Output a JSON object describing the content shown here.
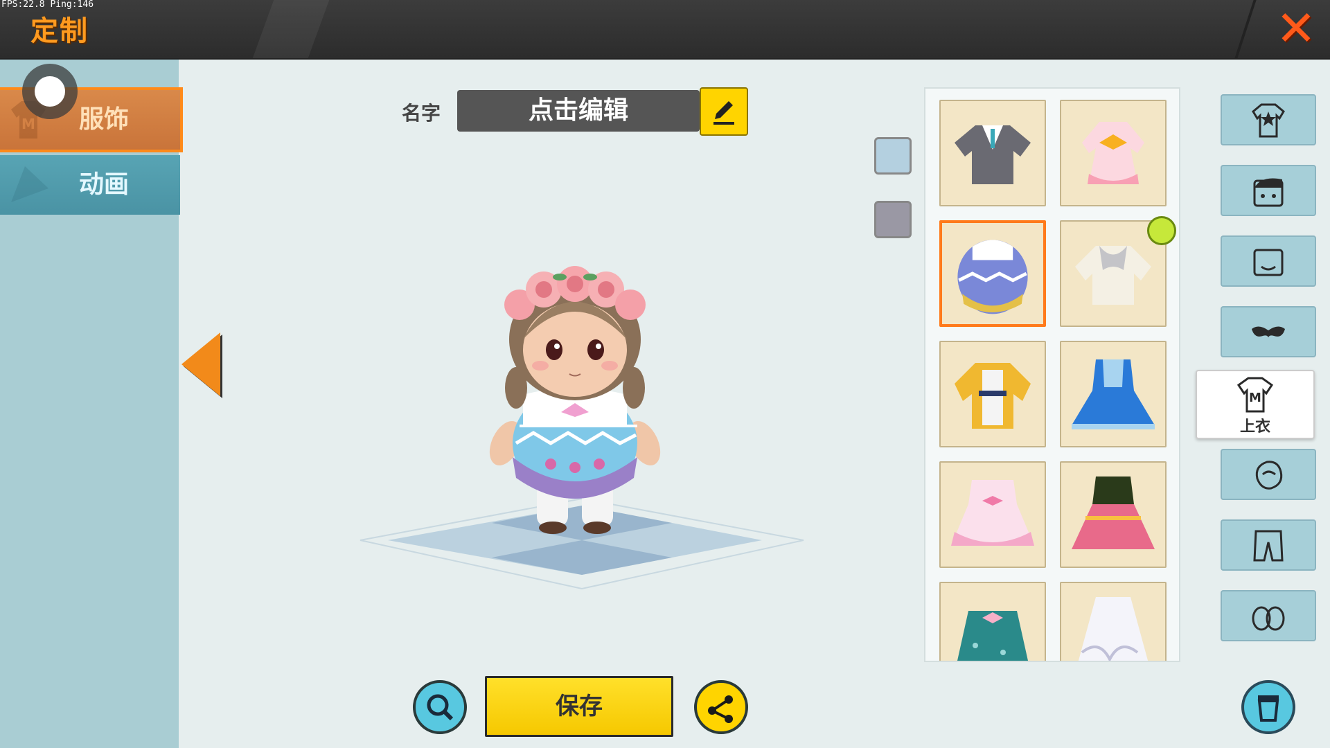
{
  "hud": {
    "fps": "FPS:22.8  Ping:146"
  },
  "header": {
    "title": "定制",
    "close_icon": "close-icon"
  },
  "left_tabs": [
    {
      "label": "服饰",
      "icon": "shirt-m-icon",
      "active": true
    },
    {
      "label": "动画",
      "icon": "triangle-icon",
      "active": false
    }
  ],
  "name_field": {
    "label": "名字",
    "value": "点击编辑",
    "edit_icon": "pencil-icon"
  },
  "colors": {
    "swatch_1": "#b4d0e0",
    "swatch_2": "#9a98a4",
    "accent": "#ff7a1a",
    "save": "#ffd400"
  },
  "items": [
    {
      "name": "gray-sweater-top",
      "selected": false
    },
    {
      "name": "pink-bow-dress-top",
      "selected": false
    },
    {
      "name": "easter-egg-costume",
      "selected": true
    },
    {
      "name": "cream-knit-sweater",
      "selected": false,
      "timed": true
    },
    {
      "name": "yellow-jacket",
      "selected": false
    },
    {
      "name": "blue-dress",
      "selected": false
    },
    {
      "name": "pink-lolita-dress",
      "selected": false
    },
    {
      "name": "green-pink-petal-dress",
      "selected": false
    },
    {
      "name": "teal-polka-dress",
      "selected": false
    },
    {
      "name": "white-feather-dress",
      "selected": false
    }
  ],
  "categories": [
    {
      "icon": "star-shirt-icon"
    },
    {
      "icon": "hair-icon"
    },
    {
      "icon": "face-icon"
    },
    {
      "icon": "mask-icon"
    },
    {
      "icon": "top-shirt-icon",
      "label": "上衣",
      "selected": true
    },
    {
      "icon": "hand-icon"
    },
    {
      "icon": "pants-icon"
    },
    {
      "icon": "shoes-icon"
    }
  ],
  "bottom": {
    "save_label": "保存",
    "zoom_icon": "zoom-icon",
    "share_icon": "share-icon",
    "trash_icon": "trash-icon"
  }
}
